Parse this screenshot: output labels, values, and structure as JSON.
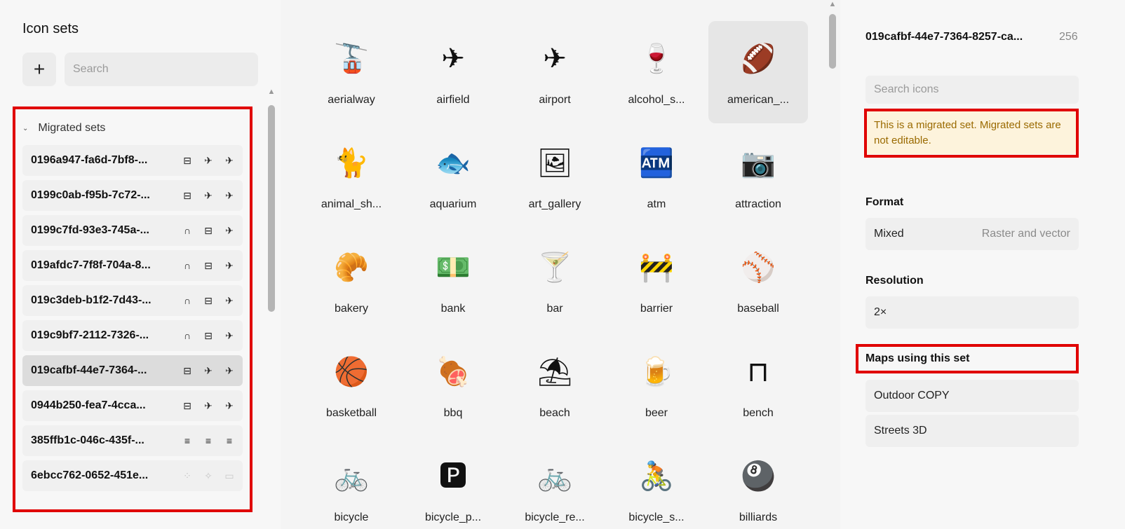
{
  "left": {
    "title": "Icon sets",
    "add_label": "+",
    "search_placeholder": "Search",
    "group_label": "Migrated sets",
    "group_chevron": "⌄",
    "sets": [
      {
        "name": "0196a947-fa6d-7bf8-...",
        "icons": [
          "⊟",
          "✈",
          "✈"
        ]
      },
      {
        "name": "0199c0ab-f95b-7c72-...",
        "icons": [
          "⊟",
          "✈",
          "✈"
        ]
      },
      {
        "name": "0199c7fd-93e3-745a-...",
        "icons": [
          "∩",
          "⊟",
          "✈"
        ]
      },
      {
        "name": "019afdc7-7f8f-704a-8...",
        "icons": [
          "∩",
          "⊟",
          "✈"
        ]
      },
      {
        "name": "019c3deb-b1f2-7d43-...",
        "icons": [
          "∩",
          "⊟",
          "✈"
        ]
      },
      {
        "name": "019c9bf7-2112-7326-...",
        "icons": [
          "∩",
          "⊟",
          "✈"
        ]
      },
      {
        "name": "019cafbf-44e7-7364-...",
        "icons": [
          "⊟",
          "✈",
          "✈"
        ],
        "selected": true
      },
      {
        "name": "0944b250-fea7-4cca...",
        "icons": [
          "⊟",
          "✈",
          "✈"
        ]
      },
      {
        "name": "385ffb1c-046c-435f-...",
        "icons": [
          "≡",
          "≡",
          "≡"
        ]
      },
      {
        "name": "6ebcc762-0652-451e...",
        "icons": [
          "⁘",
          "✧",
          "▭"
        ],
        "faded": true
      }
    ]
  },
  "grid": {
    "icons": [
      {
        "glyph": "🚡",
        "label": "aerialway"
      },
      {
        "glyph": "✈",
        "label": "airfield"
      },
      {
        "glyph": "✈",
        "label": "airport"
      },
      {
        "glyph": "🍷",
        "label": "alcohol_s..."
      },
      {
        "glyph": "🏈",
        "label": "american_...",
        "active": true
      },
      {
        "glyph": "🐈",
        "label": "animal_sh..."
      },
      {
        "glyph": "🐟",
        "label": "aquarium"
      },
      {
        "glyph": "🖼",
        "label": "art_gallery"
      },
      {
        "glyph": "🏧",
        "label": "atm"
      },
      {
        "glyph": "📷",
        "label": "attraction"
      },
      {
        "glyph": "🥐",
        "label": "bakery"
      },
      {
        "glyph": "💵",
        "label": "bank"
      },
      {
        "glyph": "🍸",
        "label": "bar"
      },
      {
        "glyph": "🚧",
        "label": "barrier"
      },
      {
        "glyph": "⚾",
        "label": "baseball"
      },
      {
        "glyph": "🏀",
        "label": "basketball"
      },
      {
        "glyph": "🍖",
        "label": "bbq"
      },
      {
        "glyph": "⛱",
        "label": "beach"
      },
      {
        "glyph": "🍺",
        "label": "beer"
      },
      {
        "glyph": "⊓",
        "label": "bench"
      },
      {
        "glyph": "🚲",
        "label": "bicycle"
      },
      {
        "glyph": "🅿",
        "label": "bicycle_p..."
      },
      {
        "glyph": "🚲",
        "label": "bicycle_re..."
      },
      {
        "glyph": "🚴",
        "label": "bicycle_s..."
      },
      {
        "glyph": "🎱",
        "label": "billiards"
      }
    ]
  },
  "right": {
    "set_title": "019cafbf-44e7-7364-8257-ca...",
    "icon_count": "256",
    "search_placeholder": "Search icons",
    "warning": "This is a migrated set. Migrated sets are not editable.",
    "format_label": "Format",
    "format_value": "Mixed",
    "format_secondary": "Raster and vector",
    "resolution_label": "Resolution",
    "resolution_value": "2×",
    "maps_label": "Maps using this set",
    "maps": [
      "Outdoor COPY",
      "Streets 3D"
    ]
  },
  "colors": {
    "highlight": "#e00000",
    "warning_bg": "#fdf3dc",
    "warning_text": "#9a6a00",
    "selected_bg": "#dcdcdc"
  }
}
